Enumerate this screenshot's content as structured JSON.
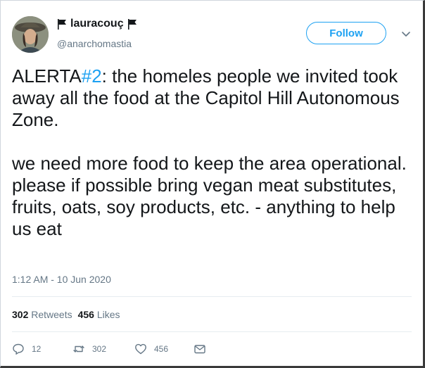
{
  "user": {
    "display_name": "lauracouç",
    "handle": "@anarchomastia",
    "avatar_icon": "avatar-photo"
  },
  "follow_button": {
    "label": "Follow"
  },
  "tweet": {
    "hashtag_prefix": "ALERTA",
    "hashtag": "#2",
    "paragraph1_rest": ": the homeles people we invited took away all the food at the Capitol Hill Autonomous Zone.",
    "paragraph2": "we need more food to keep the area operational. please if possible bring vegan meat substitutes, fruits, oats, soy products, etc. - anything to help us eat",
    "timestamp": "1:12 AM - 10 Jun 2020"
  },
  "stats": {
    "retweets_count": "302",
    "retweets_label": "Retweets",
    "likes_count": "456",
    "likes_label": "Likes"
  },
  "actions": {
    "reply_count": "12",
    "retweet_count": "302",
    "like_count": "456"
  },
  "colors": {
    "accent": "#1da1f2",
    "text": "#14171a",
    "muted": "#657786"
  }
}
